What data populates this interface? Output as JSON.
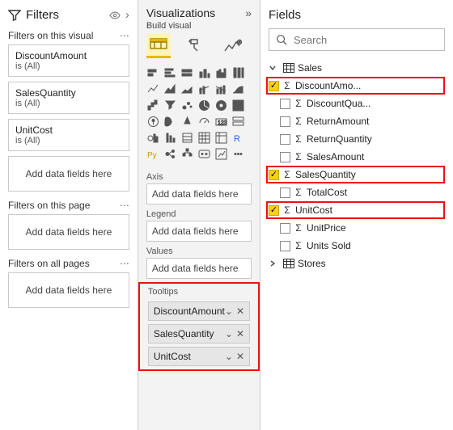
{
  "filters": {
    "title": "Filters",
    "sections": {
      "visual": {
        "label": "Filters on this visual",
        "add": "Add data fields here"
      },
      "page": {
        "label": "Filters on this page",
        "add": "Add data fields here"
      },
      "all": {
        "label": "Filters on all pages",
        "add": "Add data fields here"
      }
    },
    "cards": [
      {
        "name": "DiscountAmount",
        "state": "is (All)"
      },
      {
        "name": "SalesQuantity",
        "state": "is (All)"
      },
      {
        "name": "UnitCost",
        "state": "is (All)"
      }
    ]
  },
  "viz": {
    "title": "Visualizations",
    "subtitle": "Build visual",
    "wells": {
      "axis": {
        "label": "Axis",
        "placeholder": "Add data fields here"
      },
      "legend": {
        "label": "Legend",
        "placeholder": "Add data fields here"
      },
      "values": {
        "label": "Values",
        "placeholder": "Add data fields here"
      },
      "tooltips": {
        "label": "Tooltips",
        "items": [
          "DiscountAmount",
          "SalesQuantity",
          "UnitCost"
        ]
      }
    },
    "palette_icons": [
      "bar-stacked",
      "bar-clustered",
      "bar-100",
      "column-stacked",
      "column-clustered",
      "column-100",
      "line",
      "area",
      "area-stacked",
      "line-col",
      "line-col2",
      "ribbon",
      "waterfall",
      "funnel",
      "scatter",
      "pie",
      "donut",
      "treemap",
      "map",
      "filled-map",
      "azure-map",
      "gauge",
      "card",
      "multi-row-card",
      "kpi",
      "kpi2",
      "slicer",
      "table",
      "matrix",
      "r-visual",
      "py-visual",
      "key-influencers",
      "decomp",
      "qna",
      "paginated",
      "more"
    ]
  },
  "fields": {
    "title": "Fields",
    "search_placeholder": "Search",
    "tables": [
      {
        "name": "Sales",
        "expanded": true,
        "columns": [
          {
            "name": "DiscountAmo...",
            "checked": true,
            "highlight": true
          },
          {
            "name": "DiscountQua...",
            "checked": false,
            "highlight": false
          },
          {
            "name": "ReturnAmount",
            "checked": false,
            "highlight": false
          },
          {
            "name": "ReturnQuantity",
            "checked": false,
            "highlight": false
          },
          {
            "name": "SalesAmount",
            "checked": false,
            "highlight": false
          },
          {
            "name": "SalesQuantity",
            "checked": true,
            "highlight": true
          },
          {
            "name": "TotalCost",
            "checked": false,
            "highlight": false
          },
          {
            "name": "UnitCost",
            "checked": true,
            "highlight": true
          },
          {
            "name": "UnitPrice",
            "checked": false,
            "highlight": false
          },
          {
            "name": "Units Sold",
            "checked": false,
            "highlight": false
          }
        ]
      },
      {
        "name": "Stores",
        "expanded": false,
        "columns": []
      }
    ]
  }
}
